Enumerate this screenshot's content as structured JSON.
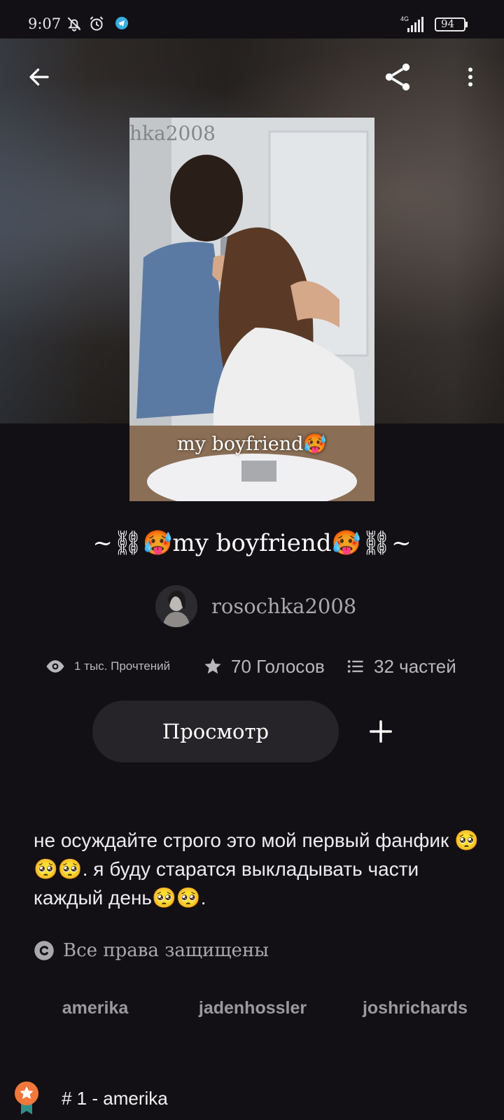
{
  "status_bar": {
    "time": "9:07",
    "network": "4G",
    "battery": "94",
    "icons": [
      "bell-off-icon",
      "alarm-icon",
      "telegram-icon",
      "signal-icon",
      "battery-icon"
    ]
  },
  "toolbar": {
    "back_icon": "arrow-left-icon",
    "share_icon": "share-icon",
    "more_icon": "more-vertical-icon"
  },
  "cover": {
    "watermark": "hka2008",
    "caption": "my boyfriend🥵"
  },
  "story": {
    "title": "~⛓🥵my boyfriend🥵⛓~",
    "author": "rosochka2008",
    "stats": {
      "reads": "1 тыс. Прочтений",
      "votes": "70 Голосов",
      "parts": "32 частей"
    },
    "read_button": "Просмотр",
    "description": "не осуждайте строго это мой первый фанфик 🥺🥺🥺. я буду старатся выкладывать части каждый день🥺🥺.",
    "copyright": "Все права защищены",
    "tags": [
      "amerika",
      "jadenhossler",
      "joshrichards"
    ],
    "ranking": "# 1 - amerika"
  },
  "colors": {
    "background": "#121014",
    "button": "#262428",
    "muted_text": "#a9a9ad",
    "ranking_badge": "#f0783c"
  }
}
